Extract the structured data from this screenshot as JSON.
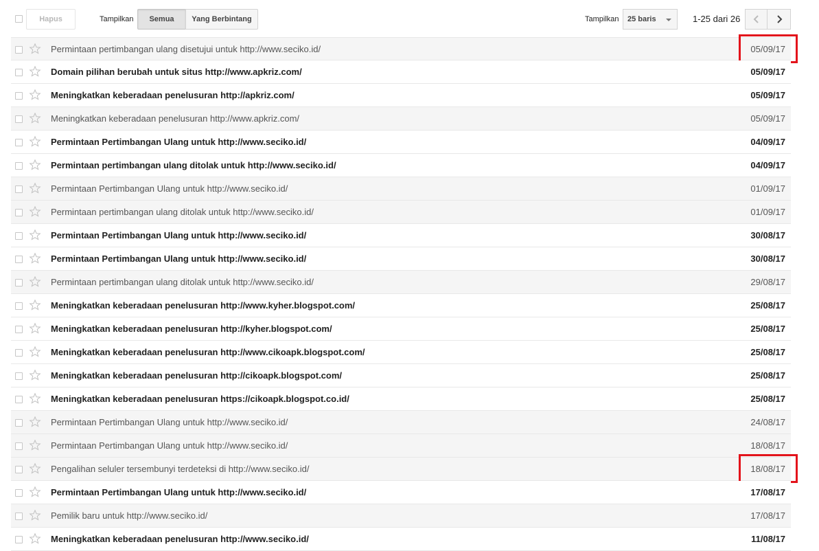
{
  "toolbar": {
    "delete_label": "Hapus",
    "show_label": "Tampilkan",
    "filter_all": "Semua",
    "filter_starred": "Yang Berbintang",
    "rows_label": "Tampilkan",
    "rows_value": "25 baris",
    "page_info": "1-25 dari 26"
  },
  "icons": {
    "star": "star-outline-icon",
    "prev": "chevron-left-icon",
    "next": "chevron-right-icon",
    "caret": "caret-down-icon"
  },
  "colors": {
    "highlight": "#e3131b",
    "read_row": "#f5f5f5"
  },
  "messages": [
    {
      "subject": "Permintaan pertimbangan ulang disetujui untuk http://www.seciko.id/",
      "date": "05/09/17",
      "read": true,
      "highlighted": true
    },
    {
      "subject": "Domain pilihan berubah untuk situs http://www.apkriz.com/",
      "date": "05/09/17",
      "read": false,
      "highlighted": false
    },
    {
      "subject": "Meningkatkan keberadaan penelusuran http://apkriz.com/",
      "date": "05/09/17",
      "read": false,
      "highlighted": false
    },
    {
      "subject": "Meningkatkan keberadaan penelusuran http://www.apkriz.com/",
      "date": "05/09/17",
      "read": true,
      "highlighted": false
    },
    {
      "subject": "Permintaan Pertimbangan Ulang untuk http://www.seciko.id/",
      "date": "04/09/17",
      "read": false,
      "highlighted": false
    },
    {
      "subject": "Permintaan pertimbangan ulang ditolak untuk http://www.seciko.id/",
      "date": "04/09/17",
      "read": false,
      "highlighted": false
    },
    {
      "subject": "Permintaan Pertimbangan Ulang untuk http://www.seciko.id/",
      "date": "01/09/17",
      "read": true,
      "highlighted": false
    },
    {
      "subject": "Permintaan pertimbangan ulang ditolak untuk http://www.seciko.id/",
      "date": "01/09/17",
      "read": true,
      "highlighted": false
    },
    {
      "subject": "Permintaan Pertimbangan Ulang untuk http://www.seciko.id/",
      "date": "30/08/17",
      "read": false,
      "highlighted": false
    },
    {
      "subject": "Permintaan Pertimbangan Ulang untuk http://www.seciko.id/",
      "date": "30/08/17",
      "read": false,
      "highlighted": false
    },
    {
      "subject": "Permintaan pertimbangan ulang ditolak untuk http://www.seciko.id/",
      "date": "29/08/17",
      "read": true,
      "highlighted": false
    },
    {
      "subject": "Meningkatkan keberadaan penelusuran http://www.kyher.blogspot.com/",
      "date": "25/08/17",
      "read": false,
      "highlighted": false
    },
    {
      "subject": "Meningkatkan keberadaan penelusuran http://kyher.blogspot.com/",
      "date": "25/08/17",
      "read": false,
      "highlighted": false
    },
    {
      "subject": "Meningkatkan keberadaan penelusuran http://www.cikoapk.blogspot.com/",
      "date": "25/08/17",
      "read": false,
      "highlighted": false
    },
    {
      "subject": "Meningkatkan keberadaan penelusuran http://cikoapk.blogspot.com/",
      "date": "25/08/17",
      "read": false,
      "highlighted": false
    },
    {
      "subject": "Meningkatkan keberadaan penelusuran https://cikoapk.blogspot.co.id/",
      "date": "25/08/17",
      "read": false,
      "highlighted": false
    },
    {
      "subject": "Permintaan Pertimbangan Ulang untuk http://www.seciko.id/",
      "date": "24/08/17",
      "read": true,
      "highlighted": false
    },
    {
      "subject": "Permintaan Pertimbangan Ulang untuk http://www.seciko.id/",
      "date": "18/08/17",
      "read": true,
      "highlighted": false
    },
    {
      "subject": "Pengalihan seluler tersembunyi terdeteksi di http://www.seciko.id/",
      "date": "18/08/17",
      "read": true,
      "highlighted": true
    },
    {
      "subject": "Permintaan Pertimbangan Ulang untuk http://www.seciko.id/",
      "date": "17/08/17",
      "read": false,
      "highlighted": false
    },
    {
      "subject": "Pemilik baru untuk http://www.seciko.id/",
      "date": "17/08/17",
      "read": true,
      "highlighted": false
    },
    {
      "subject": "Meningkatkan keberadaan penelusuran http://www.seciko.id/",
      "date": "11/08/17",
      "read": false,
      "highlighted": false
    }
  ]
}
